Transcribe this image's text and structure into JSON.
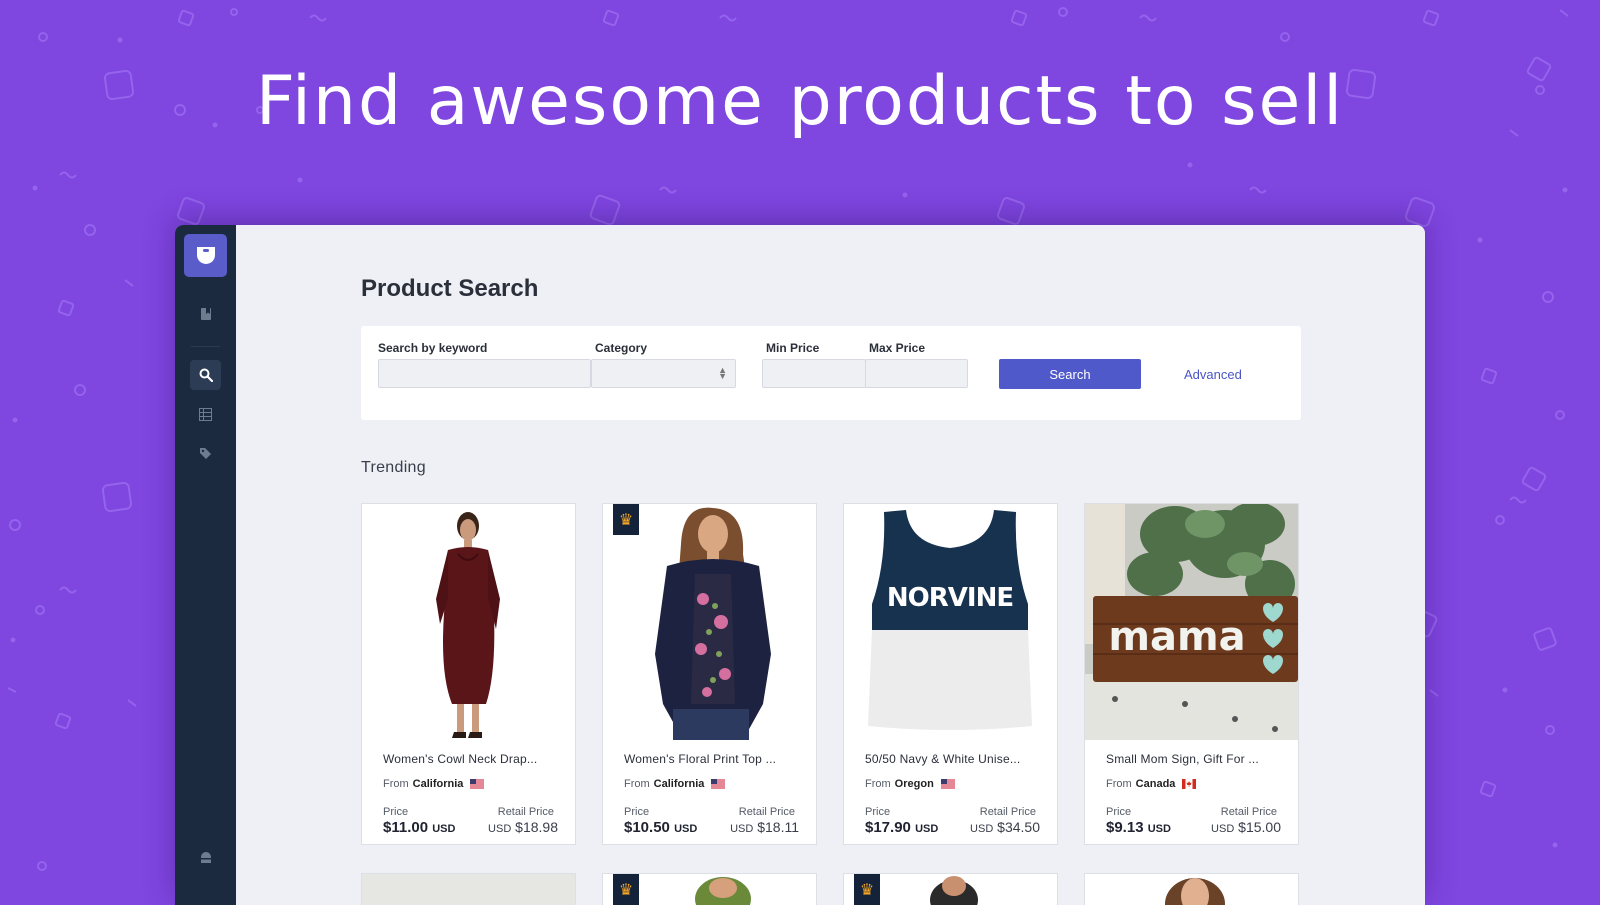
{
  "hero": {
    "headline": "Find awesome products to sell"
  },
  "colors": {
    "background": "#7f46e0",
    "sidebar": "#1b2a3e",
    "accent": "#5059c9",
    "crown": "#f5a623"
  },
  "sidebar": {
    "logo_icon": "shopping-bag-icon",
    "items": [
      {
        "icon": "bookmark-icon",
        "active": false
      },
      {
        "icon": "search-icon",
        "active": true
      },
      {
        "icon": "table-icon",
        "active": false
      },
      {
        "icon": "tag-icon",
        "active": false
      },
      {
        "icon": "store-icon",
        "active": false
      }
    ]
  },
  "page": {
    "title": "Product Search",
    "section_title": "Trending"
  },
  "search": {
    "keyword_label": "Search by keyword",
    "keyword_value": "",
    "category_label": "Category",
    "category_value": "",
    "min_price_label": "Min Price",
    "min_price_value": "",
    "max_price_label": "Max Price",
    "max_price_value": "",
    "search_button": "Search",
    "advanced_link": "Advanced"
  },
  "products": [
    {
      "title": "Women's Cowl Neck Drap...",
      "from_label": "From",
      "origin": "California",
      "flag": "us-flag-icon",
      "premium": false,
      "price_label": "Price",
      "price": "$11.00",
      "price_currency": "USD",
      "retail_label": "Retail Price",
      "retail_currency": "USD",
      "retail_price": "$18.98"
    },
    {
      "title": "Women's Floral Print Top ...",
      "from_label": "From",
      "origin": "California",
      "flag": "us-flag-icon",
      "premium": true,
      "price_label": "Price",
      "price": "$10.50",
      "price_currency": "USD",
      "retail_label": "Retail Price",
      "retail_currency": "USD",
      "retail_price": "$18.11"
    },
    {
      "title": "50/50 Navy & White Unise...",
      "from_label": "From",
      "origin": "Oregon",
      "flag": "us-flag-icon",
      "premium": false,
      "image_text": "NORVINE",
      "price_label": "Price",
      "price": "$17.90",
      "price_currency": "USD",
      "retail_label": "Retail Price",
      "retail_currency": "USD",
      "retail_price": "$34.50"
    },
    {
      "title": "Small Mom Sign, Gift For ...",
      "from_label": "From",
      "origin": "Canada",
      "flag": "canada-flag-icon",
      "premium": false,
      "image_text": "mama",
      "price_label": "Price",
      "price": "$9.13",
      "price_currency": "USD",
      "retail_label": "Retail Price",
      "retail_currency": "USD",
      "retail_price": "$15.00"
    }
  ],
  "next_row": [
    {
      "premium": false
    },
    {
      "premium": true
    },
    {
      "premium": true
    },
    {
      "premium": false
    }
  ]
}
